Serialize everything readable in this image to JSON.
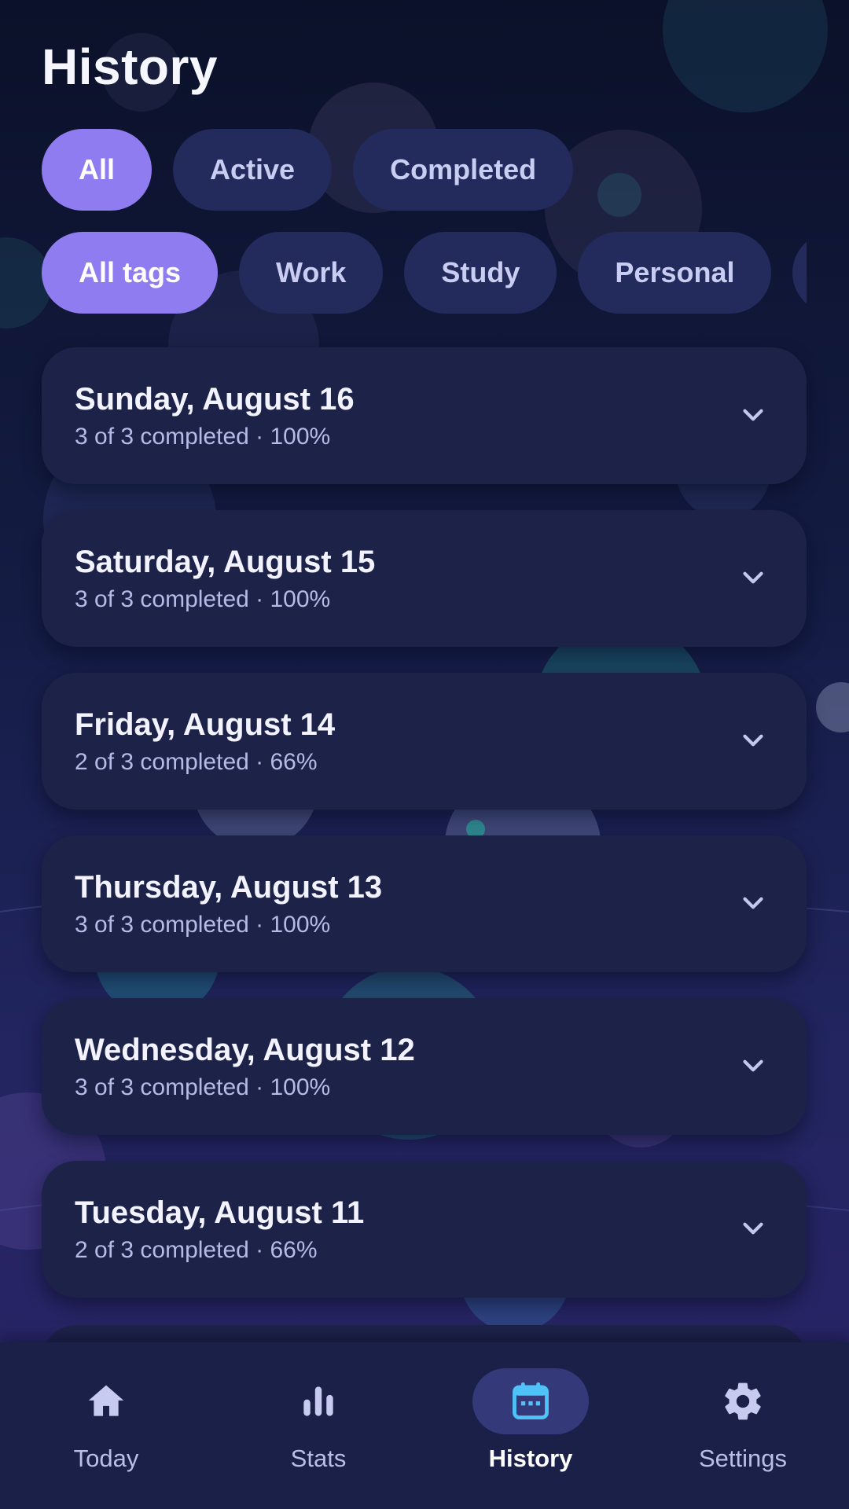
{
  "page": {
    "title": "History"
  },
  "status_filters": [
    {
      "label": "All",
      "active": true
    },
    {
      "label": "Active",
      "active": false
    },
    {
      "label": "Completed",
      "active": false
    }
  ],
  "tag_filters": [
    {
      "label": "All tags",
      "active": true
    },
    {
      "label": "Work",
      "active": false
    },
    {
      "label": "Study",
      "active": false
    },
    {
      "label": "Personal",
      "active": false
    },
    {
      "label": "",
      "active": false
    }
  ],
  "days": [
    {
      "title": "Sunday, August 16",
      "summary": "3 of 3 completed · 100%",
      "icon": "chevron-down-icon"
    },
    {
      "title": "Saturday, August 15",
      "summary": "3 of 3 completed · 100%",
      "icon": "chevron-down-icon"
    },
    {
      "title": "Friday, August 14",
      "summary": "2 of 3 completed · 66%",
      "icon": "chevron-down-icon"
    },
    {
      "title": "Thursday, August 13",
      "summary": "3 of 3 completed · 100%",
      "icon": "chevron-down-icon"
    },
    {
      "title": "Wednesday, August 12",
      "summary": "3 of 3 completed · 100%",
      "icon": "chevron-down-icon"
    },
    {
      "title": "Tuesday, August 11",
      "summary": "2 of 3 completed · 66%",
      "icon": "chevron-down-icon"
    }
  ],
  "nav": [
    {
      "label": "Today",
      "icon": "home-icon",
      "selected": false
    },
    {
      "label": "Stats",
      "icon": "bar-chart-icon",
      "selected": false
    },
    {
      "label": "History",
      "icon": "calendar-icon",
      "selected": true
    },
    {
      "label": "Settings",
      "icon": "gear-icon",
      "selected": false
    }
  ],
  "colors": {
    "accent": "#8f7cf0",
    "chip": "#232a5c",
    "card": "#1d2249",
    "nav_bar": "#1b2048",
    "calendar_icon": "#4fc3f7"
  }
}
